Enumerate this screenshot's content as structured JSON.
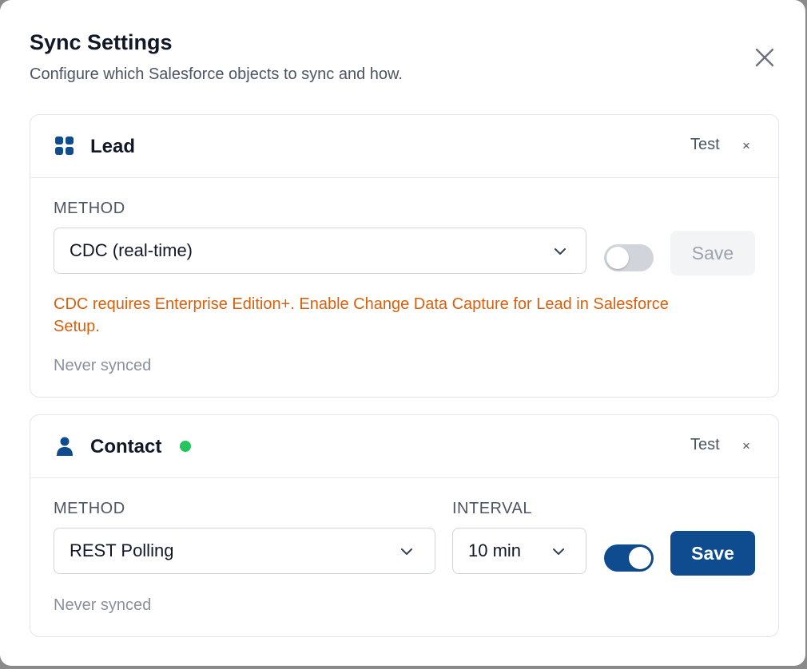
{
  "modal": {
    "title": "Sync Settings",
    "subtitle": "Configure which Salesforce objects to sync and how."
  },
  "colors": {
    "accent": "#0f4c8f",
    "warning": "#d9600c",
    "status_active": "#22c55e",
    "toggle_off": "#d1d5db"
  },
  "objects": [
    {
      "name": "Lead",
      "icon": "grid-icon",
      "test_label": "Test",
      "remove_label": "×",
      "method_label": "METHOD",
      "method_value": "CDC (real-time)",
      "enabled": false,
      "save_label": "Save",
      "save_disabled": true,
      "warning": "CDC requires Enterprise Edition+. Enable Change Data Capture for Lead in Salesforce Setup.",
      "sync_status": "Never synced"
    },
    {
      "name": "Contact",
      "icon": "person-icon",
      "active": true,
      "test_label": "Test",
      "remove_label": "×",
      "method_label": "METHOD",
      "method_value": "REST Polling",
      "interval_label": "INTERVAL",
      "interval_value": "10 min",
      "enabled": true,
      "save_label": "Save",
      "save_disabled": false,
      "sync_status": "Never synced"
    }
  ]
}
